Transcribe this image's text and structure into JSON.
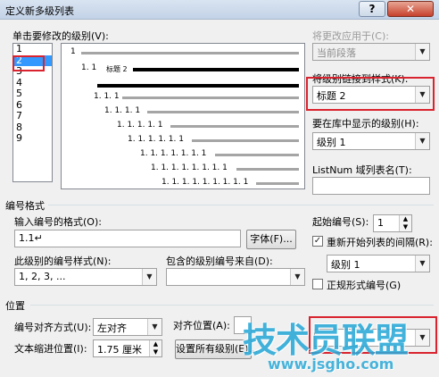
{
  "window": {
    "title": "定义新多级列表",
    "help": "?",
    "close": "✕"
  },
  "level_label": "单击要修改的级别(V):",
  "levels": [
    "1",
    "2",
    "3",
    "4",
    "5",
    "6",
    "7",
    "8",
    "9"
  ],
  "selected_level_index": 1,
  "preview": {
    "rows": [
      "1",
      "1. 1",
      "1. 1. 1",
      "1. 1. 1. 1",
      "1. 1. 1. 1. 1",
      "1. 1. 1. 1. 1. 1",
      "1. 1. 1. 1. 1. 1. 1",
      "1. 1. 1. 1. 1. 1. 1. 1",
      "1. 1. 1. 1. 1. 1. 1. 1. 1"
    ],
    "heading2_text": "标题 2"
  },
  "apply_to": {
    "label": "将更改应用于(C):",
    "value": "当前段落"
  },
  "link_style": {
    "label": "将级别链接到样式(K):",
    "value": "标题 2"
  },
  "gallery_level": {
    "label": "要在库中显示的级别(H):",
    "value": "级别 1"
  },
  "listnum": {
    "label": "ListNum 域列表名(T):",
    "value": ""
  },
  "number_format": {
    "section": "编号格式",
    "format_label": "输入编号的格式(O):",
    "format_value": "1.1↵",
    "font_button": "字体(F)...",
    "style_label": "此级别的编号样式(N):",
    "style_value": "1, 2, 3, ...",
    "include_label": "包含的级别编号来自(D):",
    "include_value": "",
    "start_label": "起始编号(S):",
    "start_value": "1",
    "restart_label": "重新开始列表的间隔(R):",
    "restart_checked": true,
    "restart_value": "级别 1",
    "legal_label": "正规形式编号(G)",
    "legal_checked": false
  },
  "position": {
    "section": "位置",
    "align_label": "编号对齐方式(U):",
    "align_value": "左对齐",
    "aligned_at_label": "对齐位置(A):",
    "indent_label": "文本缩进位置(I):",
    "indent_value": "1.75 厘米",
    "set_all_button": "设置所有级别(E)..."
  },
  "watermark": {
    "text": "技术员联盟",
    "url": "www.jsgho.com"
  },
  "colors": {
    "highlight": "#d9232e",
    "selection": "#3399ff",
    "watermark": "#2aa9d8"
  }
}
